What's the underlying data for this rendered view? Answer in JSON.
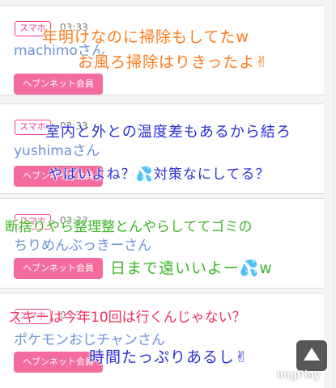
{
  "posts": [
    {
      "badge": "スマホ",
      "time": "03:33",
      "username": "machimoさん",
      "member_button": "ヘブンネット会員",
      "overlay_lines": [
        "年明けなのに掃除もしてたw",
        "お風ろ掃除はりきったよ✌"
      ]
    },
    {
      "badge": "スマホ",
      "time": "03:33",
      "username": "yushimaさん",
      "member_button": "ヘブンネット会員",
      "overlay_lines": [
        "室内と外との温度差もあるから結ろ",
        "やばいよね？💦対策なにしてる？"
      ]
    },
    {
      "badge": "スマホ",
      "time": "03:33",
      "username": "ちりめんぶっきーさん",
      "member_button": "ヘブンネット会員",
      "overlay_lines": [
        "断捨りやら整理整とんやらしててゴミの",
        "日まで遠いいよー💦w"
      ]
    },
    {
      "badge": "スマホ",
      "time": "03:33",
      "username": "ポケモンおじチャンさん",
      "member_button": "ヘブンネット会員",
      "overlay_lines": [
        "スキーは今年10回は行くんじゃない？",
        "時間たっぷりあるし✌"
      ]
    }
  ],
  "watermark": "ImgPlay",
  "colors": {
    "badge": "#e9418b",
    "member_button": "#f36c9d",
    "username": "#6b93d6",
    "overlay_orange": "#ff7a1a",
    "overlay_blue": "#2a2fd6",
    "overlay_green": "#3fb52a",
    "overlay_red": "#f0325a"
  },
  "icons": [
    "scroll-to-top-icon"
  ]
}
